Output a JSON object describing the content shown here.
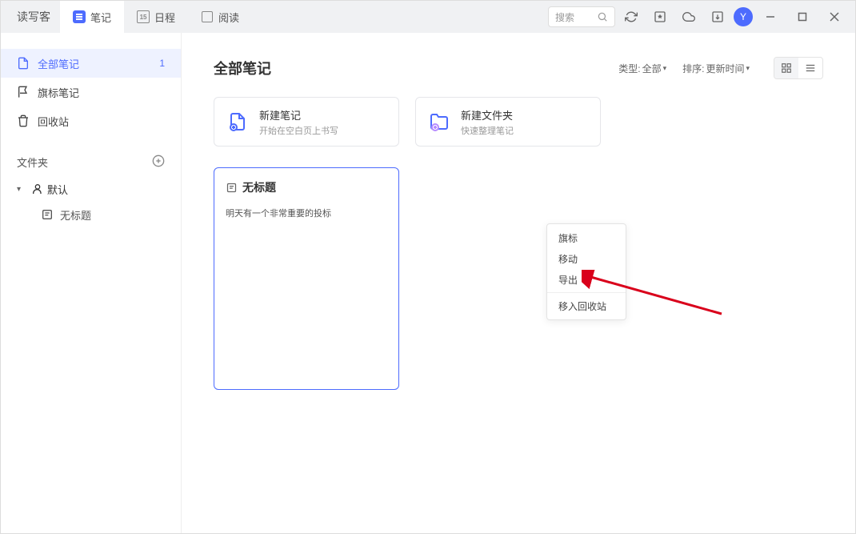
{
  "app_name": "读写客",
  "tabs": {
    "notes": "笔记",
    "schedule": "日程",
    "reading": "阅读",
    "cal_num": "15"
  },
  "search": {
    "placeholder": "搜索"
  },
  "avatar": "Y",
  "sidebar": {
    "all": {
      "label": "全部笔记",
      "count": "1"
    },
    "flag": {
      "label": "旗标笔记"
    },
    "trash": {
      "label": "回收站"
    },
    "folders_header": "文件夹",
    "default_folder": "默认",
    "untitled": "无标题"
  },
  "main": {
    "title": "全部笔记",
    "filter_type_label": "类型:",
    "filter_type_value": "全部",
    "sort_label": "排序:",
    "sort_value": "更新时间"
  },
  "actions": {
    "new_note": {
      "title": "新建笔记",
      "sub": "开始在空白页上书写"
    },
    "new_folder": {
      "title": "新建文件夹",
      "sub": "快速整理笔记"
    }
  },
  "note": {
    "title": "无标题",
    "body": "明天有一个非常重要的投标"
  },
  "ctx": {
    "flag": "旗标",
    "move": "移动",
    "export": "导出",
    "trash": "移入回收站"
  }
}
